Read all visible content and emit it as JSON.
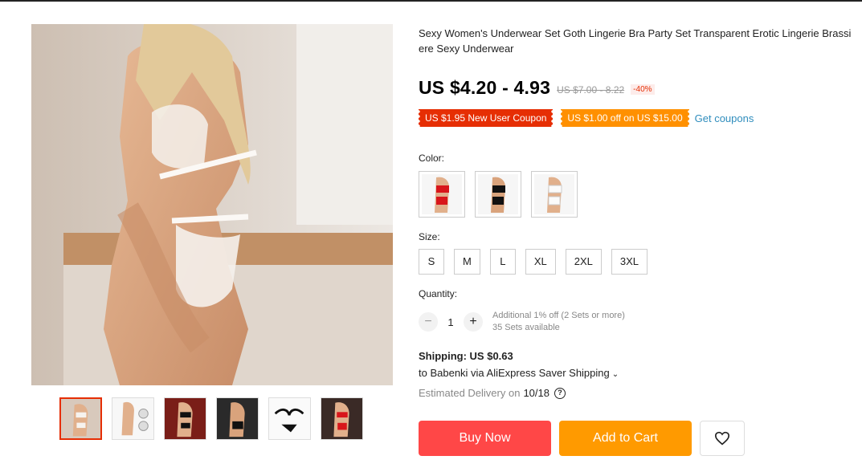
{
  "product": {
    "title": "Sexy Women's Underwear Set Goth Lingerie Bra Party Set Transparent Erotic Lingerie Brassiere Sexy Underwear",
    "price": "US $4.20 - 4.93",
    "old_price": "US $7.00 - 8.22",
    "discount": "-40%"
  },
  "coupons": {
    "new_user": "US $1.95 New User Coupon",
    "store": "US $1.00 off on US $15.00",
    "get_label": "Get coupons"
  },
  "color": {
    "label": "Color:",
    "options": [
      "red-lingerie-thumbnail",
      "black-lingerie-thumbnail",
      "white-lingerie-thumbnail"
    ]
  },
  "size": {
    "label": "Size:",
    "options": [
      "S",
      "M",
      "L",
      "XL",
      "2XL",
      "3XL"
    ]
  },
  "quantity": {
    "label": "Quantity:",
    "minus": "−",
    "plus": "+",
    "value": "1",
    "discount_note": "Additional 1% off (2 Sets or more)",
    "available": "35 Sets available"
  },
  "shipping": {
    "label": "Shipping: US $0.63",
    "to": "to Babenki via AliExpress Saver Shipping",
    "chevron_icon": "chevron-down-icon",
    "delivery_label": "Estimated Delivery on",
    "delivery_date": "10/18",
    "help_icon": "?"
  },
  "actions": {
    "buy_now": "Buy Now",
    "add_to_cart": "Add to Cart",
    "wishlist_icon": "heart-icon"
  },
  "gallery": {
    "thumbnail_count": 6,
    "active_index": 0
  }
}
